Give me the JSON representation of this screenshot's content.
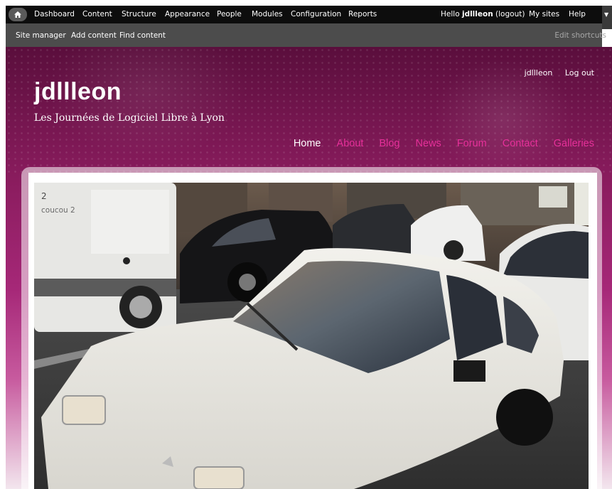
{
  "toolbar": {
    "menu": [
      "Dashboard",
      "Content",
      "Structure",
      "Appearance",
      "People",
      "Modules",
      "Configuration",
      "Reports"
    ],
    "hello_prefix": "Hello",
    "username": "jdllleon",
    "logout": "(logout)",
    "my_sites": "My sites",
    "help": "Help"
  },
  "shortcuts": {
    "items": [
      "Site manager",
      "Add content",
      "Find content"
    ],
    "edit": "Edit shortcuts"
  },
  "header": {
    "user_links": [
      "jdllleon",
      "Log out"
    ],
    "site_name": "jdllleon",
    "slogan": "Les Journées de Logiciel Libre à Lyon",
    "menu": [
      {
        "label": "Home",
        "active": true
      },
      {
        "label": "About"
      },
      {
        "label": "Blog"
      },
      {
        "label": "News"
      },
      {
        "label": "Forum"
      },
      {
        "label": "Contact"
      },
      {
        "label": "Galleries"
      }
    ],
    "menu_color": "#e6309a"
  },
  "slide": {
    "number": "2",
    "caption": "coucou 2"
  }
}
